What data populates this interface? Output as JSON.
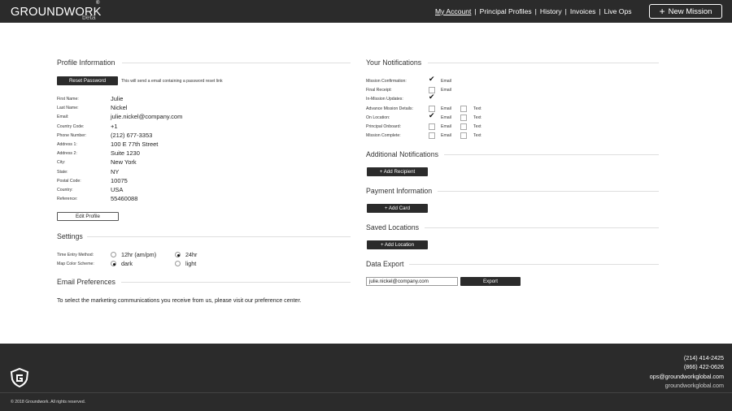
{
  "header": {
    "logo": "GROUNDWORK",
    "logo_mark": "®",
    "beta": "beta",
    "nav": [
      "My Account",
      "Principal Profiles",
      "History",
      "Invoices",
      "Live Ops"
    ],
    "new_mission_label": "New Mission"
  },
  "profile": {
    "title": "Profile Information",
    "reset_label": "Reset Password",
    "reset_note": "This will send a email containing a password reset link",
    "fields": [
      {
        "label": "First Name:",
        "value": "Julie"
      },
      {
        "label": "Last Name:",
        "value": "Nickel"
      },
      {
        "label": "Email:",
        "value": "julie.nickel@company.com"
      },
      {
        "label": "Country Code:",
        "value": "+1"
      },
      {
        "label": "Phone Number:",
        "value": "(212) 677-3353"
      },
      {
        "label": "Address 1:",
        "value": "100 E 77th Street"
      },
      {
        "label": "Address 2:",
        "value": "Suite 1230"
      },
      {
        "label": "City:",
        "value": "New York"
      },
      {
        "label": "State:",
        "value": "NY"
      },
      {
        "label": "Postal Code:",
        "value": "10075"
      },
      {
        "label": "Country:",
        "value": "USA"
      },
      {
        "label": "Reference:",
        "value": "55460088"
      }
    ],
    "edit_label": "Edit Profile"
  },
  "settings": {
    "title": "Settings",
    "time_label": "Time Entry Method:",
    "time_options": [
      "12hr (am/pm)",
      "24hr"
    ],
    "time_selected": "24hr",
    "map_label": "Map Color Scheme:",
    "map_options": [
      "dark",
      "light"
    ],
    "map_selected": "dark"
  },
  "email_prefs": {
    "title": "Email Preferences",
    "text": "To select the marketing communications you receive from us, please visit our preference center."
  },
  "notifications": {
    "title": "Your Notifications",
    "email_label": "Email",
    "text_label": "Text",
    "rows": [
      {
        "label": "Mission Confirmation:",
        "email": true,
        "email_shown": true,
        "text_shown": false
      },
      {
        "label": "Final Receipt:",
        "email": false,
        "email_shown": true,
        "text_shown": false
      },
      {
        "label": "In-Mission Updates:",
        "email": true,
        "email_shown": false,
        "text_shown": false
      },
      {
        "label": "Advance Mission Details:",
        "email": false,
        "email_shown": true,
        "text_shown": true
      },
      {
        "label": "On Location:",
        "email": true,
        "email_shown": true,
        "text_shown": true
      },
      {
        "label": "Principal Onboard:",
        "email": false,
        "email_shown": true,
        "text_shown": true
      },
      {
        "label": "Mission Complete:",
        "email": false,
        "email_shown": true,
        "text_shown": true
      }
    ]
  },
  "additional": {
    "title": "Additional Notifications",
    "button": "+ Add Recipient"
  },
  "payment": {
    "title": "Payment Information",
    "button": "+ Add Card"
  },
  "locations": {
    "title": "Saved Locations",
    "button": "+ Add Location"
  },
  "export": {
    "title": "Data Export",
    "email_value": "julie.nickel@company.com",
    "button": "Export"
  },
  "footer": {
    "phone1": "(214) 414-2425",
    "phone2": "(866) 422-0626",
    "email": "ops@groundworkglobal.com",
    "site": "groundworkglobal.com",
    "copyright": "© 2018 Groundwork. All rights reserved."
  }
}
